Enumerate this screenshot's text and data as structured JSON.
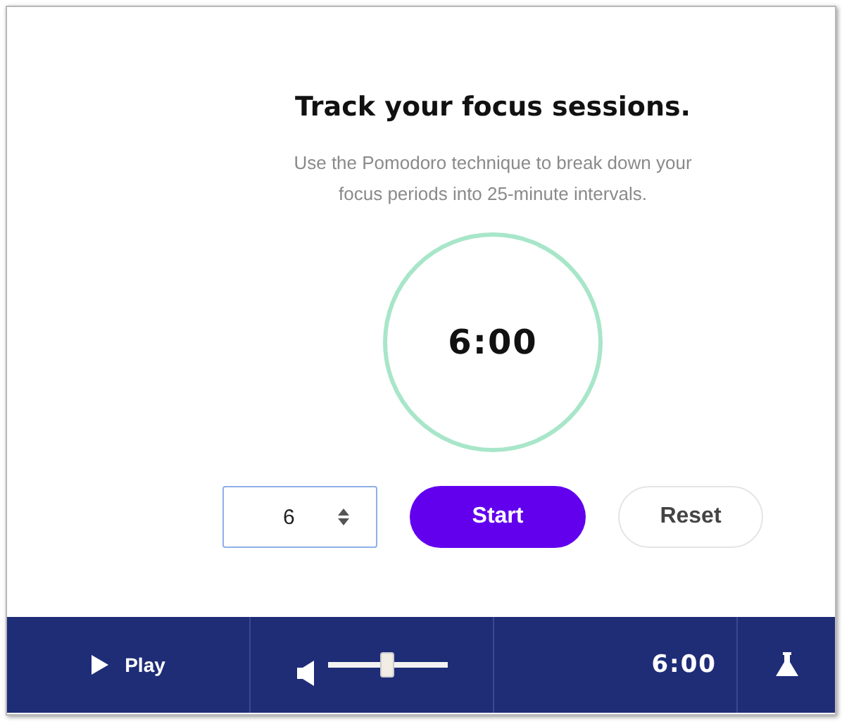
{
  "heading": "Track your focus sessions.",
  "description": "Use the Pomodoro technique to break down your focus periods into 25-minute intervals.",
  "timer": {
    "display": "6:00"
  },
  "minutes_field": {
    "value": "6"
  },
  "buttons": [
    {
      "label": "Start",
      "kind": "primary"
    },
    {
      "label": "Reset",
      "kind": "secondary"
    }
  ],
  "player_bar": {
    "play_label": "Play",
    "volume": {
      "level": 0.5
    },
    "time": "6:00"
  }
}
